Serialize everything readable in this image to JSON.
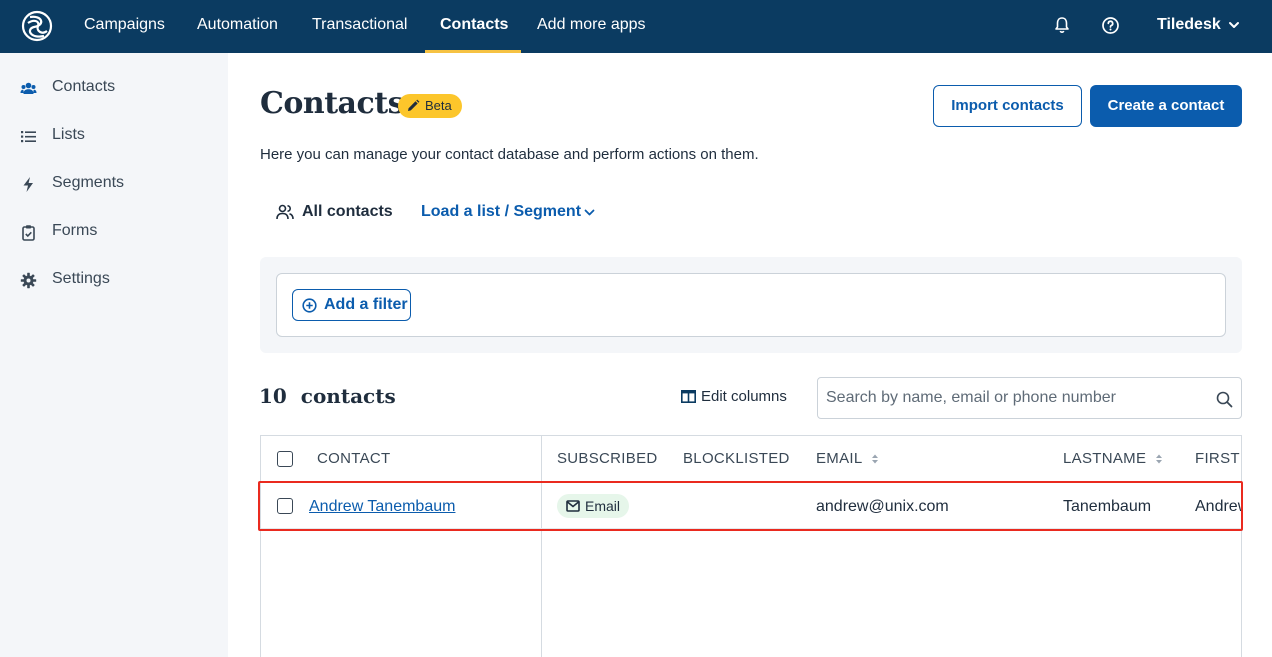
{
  "nav": {
    "items": [
      {
        "label": "Campaigns",
        "active": false
      },
      {
        "label": "Automation",
        "active": false
      },
      {
        "label": "Transactional",
        "active": false
      },
      {
        "label": "Contacts",
        "active": true
      },
      {
        "label": "Add more apps",
        "active": false
      }
    ],
    "account": "Tiledesk",
    "icons": [
      "bell-icon",
      "help-icon",
      "chevron-down-icon"
    ]
  },
  "sidebar": {
    "items": [
      {
        "label": "Contacts",
        "icon": "users-icon",
        "active": true
      },
      {
        "label": "Lists",
        "icon": "list-icon",
        "active": false
      },
      {
        "label": "Segments",
        "icon": "lightning-icon",
        "active": false
      },
      {
        "label": "Forms",
        "icon": "clipboard-icon",
        "active": false
      },
      {
        "label": "Settings",
        "icon": "gear-icon",
        "active": false
      }
    ]
  },
  "header": {
    "title": "Contacts",
    "badge": "Beta",
    "import_label": "Import contacts",
    "create_label": "Create a contact",
    "subtitle": "Here you can manage your contact database and perform actions on them."
  },
  "views": {
    "all_contacts": "All contacts",
    "load_list": "Load a list / Segment"
  },
  "filter": {
    "add_label": "Add a filter"
  },
  "toolbar": {
    "count": "10",
    "count_label": "contacts",
    "edit_columns": "Edit columns",
    "search_placeholder": "Search by name, email or phone number"
  },
  "table": {
    "columns": [
      "CONTACT",
      "SUBSCRIBED",
      "BLOCKLISTED",
      "EMAIL",
      "LASTNAME",
      "FIRSTNAME"
    ],
    "rows": [
      {
        "contact": "Andrew Tanembaum",
        "subscribed": "Email",
        "blocklisted": "",
        "email": "andrew@unix.com",
        "lastname": "Tanembaum",
        "firstname": "Andrew"
      }
    ]
  },
  "colors": {
    "nav_bg": "#0b3b61",
    "primary": "#0b5cad",
    "badge": "#fcc62b",
    "highlight": "#ea2a1f"
  }
}
